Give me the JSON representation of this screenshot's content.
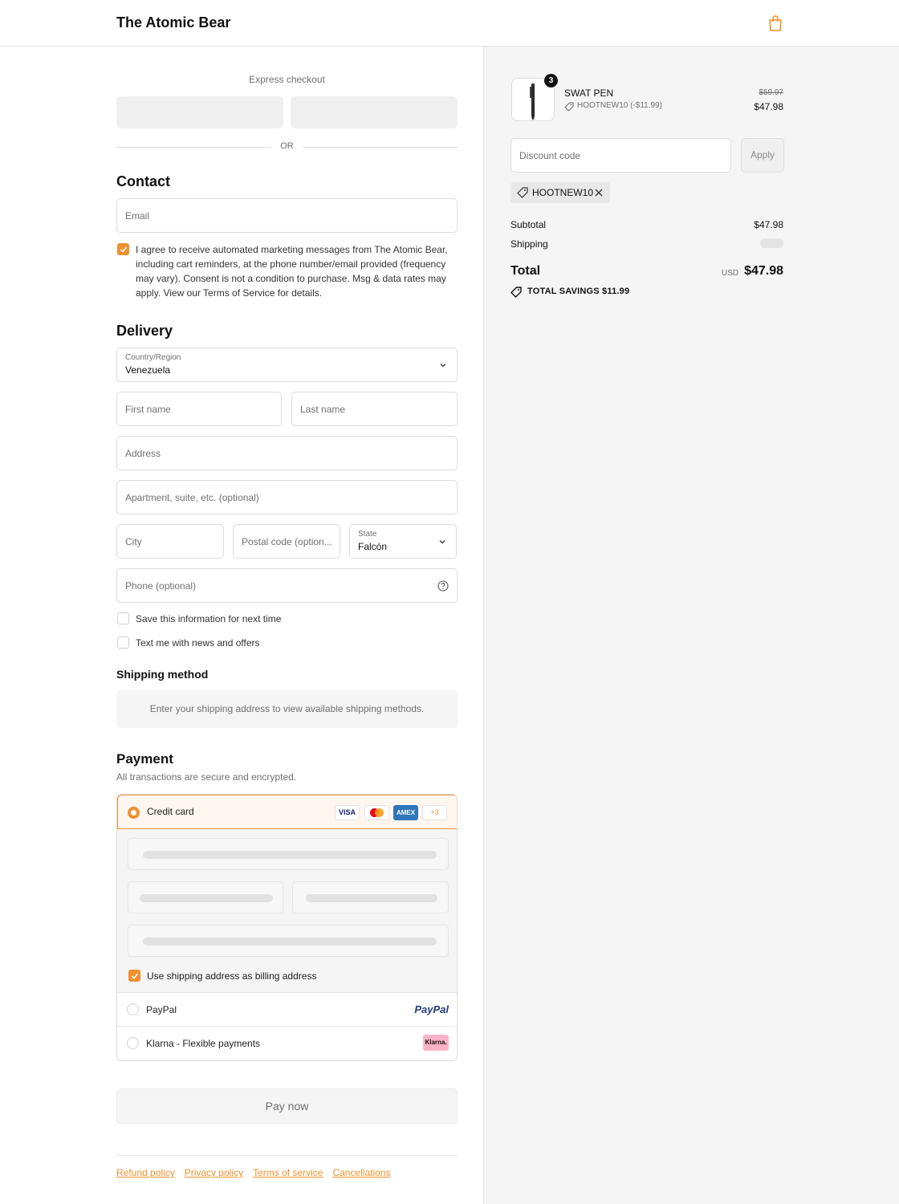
{
  "header": {
    "brand": "The Atomic Bear"
  },
  "express": {
    "label": "Express checkout",
    "or": "OR"
  },
  "contact": {
    "title": "Contact",
    "email_placeholder": "Email",
    "consent_text": "I agree to receive automated marketing messages from The Atomic Bear, including cart reminders, at the phone number/email provided (frequency may vary). Consent is not a condition to purchase. Msg & data rates may apply. View our Terms of Service for details.",
    "consent_checked": true
  },
  "delivery": {
    "title": "Delivery",
    "country_label": "Country/Region",
    "country_value": "Venezuela",
    "first_name": "First name",
    "last_name": "Last name",
    "address": "Address",
    "apartment": "Apartment, suite, etc. (optional)",
    "city": "City",
    "postal": "Postal code (option...",
    "state_label": "State",
    "state_value": "Falcón",
    "phone": "Phone (optional)",
    "save_info": "Save this information for next time",
    "text_me": "Text me with news and offers"
  },
  "shipping_method": {
    "title": "Shipping method",
    "message": "Enter your shipping address to view available shipping methods."
  },
  "payment": {
    "title": "Payment",
    "subtitle": "All transactions are secure and encrypted.",
    "credit_card": "Credit card",
    "card_logos": [
      "VISA",
      "",
      "AMEX",
      "+3"
    ],
    "billing_same": "Use shipping address as billing address",
    "paypal": "PayPal",
    "paypal_logo": "PayPal",
    "klarna": "Klarna - Flexible payments",
    "klarna_logo": "Klarna.",
    "pay_now": "Pay now"
  },
  "footer": {
    "links": [
      "Refund policy",
      "Privacy policy",
      "Terms of service",
      "Cancellations"
    ]
  },
  "summary": {
    "quantity": "3",
    "product_name": "SWAT PEN",
    "product_discount": "HOOTNEW10 (-$11.99)",
    "old_price": "$59.97",
    "new_price": "$47.98",
    "discount_placeholder": "Discount code",
    "apply": "Apply",
    "applied_code": "HOOTNEW10",
    "subtotal_label": "Subtotal",
    "subtotal_value": "$47.98",
    "shipping_label": "Shipping",
    "total_label": "Total",
    "currency": "USD",
    "total_value": "$47.98",
    "savings": "TOTAL SAVINGS  $11.99"
  },
  "colors": {
    "accent": "#f0902e",
    "panel": "#f5f5f5",
    "paypal": "#253b80",
    "klarna": "#ffb3c7"
  }
}
